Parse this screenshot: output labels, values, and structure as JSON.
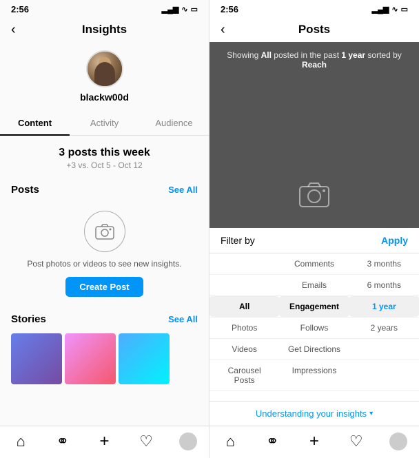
{
  "left": {
    "statusBar": {
      "time": "2:56",
      "signal": "▂▄▆",
      "wifi": "wifi",
      "battery": "battery"
    },
    "header": {
      "backLabel": "‹",
      "title": "Insights"
    },
    "profile": {
      "username": "blackw00d"
    },
    "tabs": [
      {
        "label": "Content",
        "active": true
      },
      {
        "label": "Activity",
        "active": false
      },
      {
        "label": "Audience",
        "active": false
      }
    ],
    "weekStats": {
      "count": "3 posts this week",
      "compare": "+3 vs. Oct 5 - Oct 12"
    },
    "postsSection": {
      "title": "Posts",
      "seeAll": "See All",
      "emptyText": "Post photos or videos to see new insights.",
      "createBtn": "Create Post"
    },
    "storiesSection": {
      "title": "Stories",
      "seeAll": "See All"
    },
    "bottomNav": [
      {
        "icon": "⌂",
        "name": "home"
      },
      {
        "icon": "🔍",
        "name": "search"
      },
      {
        "icon": "⊕",
        "name": "add"
      },
      {
        "icon": "♡",
        "name": "likes"
      },
      {
        "icon": "👤",
        "name": "profile"
      }
    ]
  },
  "right": {
    "statusBar": {
      "time": "2:56",
      "signal": "▂▄▆",
      "wifi": "wifi",
      "battery": "battery"
    },
    "header": {
      "backLabel": "‹",
      "title": "Posts"
    },
    "banner": {
      "text1": "Showing ",
      "highlight1": "All",
      "text2": " posted in the past ",
      "highlight2": "1 year",
      "text3": " sorted by",
      "highlight3": "Reach"
    },
    "filterSection": {
      "label": "Filter by",
      "applyBtn": "Apply"
    },
    "filterOptions": {
      "column1": [
        "",
        "Comments",
        "Emails",
        "All",
        "Photos",
        "Videos",
        "Carousel Posts"
      ],
      "column2": [
        "",
        "",
        "",
        "Engagement",
        "Follows",
        "Get Directions",
        "Impressions"
      ],
      "column3": [
        "",
        "3 months",
        "6 months",
        "1 year",
        "2 years",
        "",
        ""
      ]
    },
    "understandingBar": "Understanding your insights",
    "bottomNav": [
      {
        "icon": "⌂",
        "name": "home"
      },
      {
        "icon": "🔍",
        "name": "search"
      },
      {
        "icon": "⊕",
        "name": "add"
      },
      {
        "icon": "♡",
        "name": "likes"
      },
      {
        "icon": "👤",
        "name": "profile"
      }
    ]
  }
}
